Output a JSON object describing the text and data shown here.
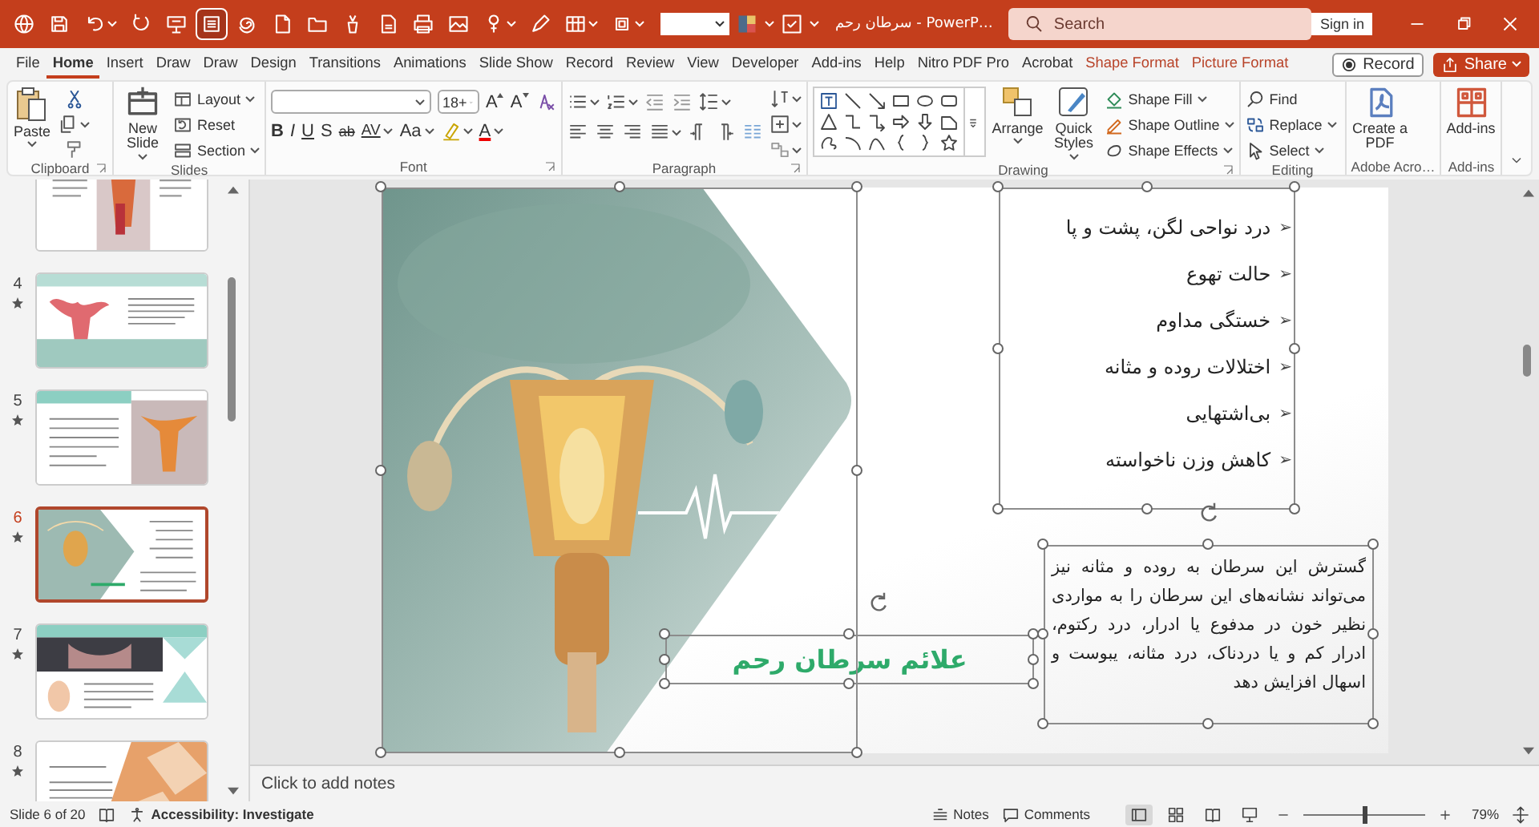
{
  "title_bar": {
    "document_title": "سرطان رحم - PowerP…",
    "search_placeholder": "Search",
    "sign_in": "Sign in"
  },
  "menu_tabs": [
    {
      "label": "File",
      "selected": false,
      "kind": "normal"
    },
    {
      "label": "Home",
      "selected": true,
      "kind": "normal"
    },
    {
      "label": "Insert",
      "selected": false,
      "kind": "normal"
    },
    {
      "label": "Draw",
      "selected": false,
      "kind": "normal"
    },
    {
      "label": "Draw",
      "selected": false,
      "kind": "normal"
    },
    {
      "label": "Design",
      "selected": false,
      "kind": "normal"
    },
    {
      "label": "Transitions",
      "selected": false,
      "kind": "normal"
    },
    {
      "label": "Animations",
      "selected": false,
      "kind": "normal"
    },
    {
      "label": "Slide Show",
      "selected": false,
      "kind": "normal"
    },
    {
      "label": "Record",
      "selected": false,
      "kind": "normal"
    },
    {
      "label": "Review",
      "selected": false,
      "kind": "normal"
    },
    {
      "label": "View",
      "selected": false,
      "kind": "normal"
    },
    {
      "label": "Developer",
      "selected": false,
      "kind": "normal"
    },
    {
      "label": "Add-ins",
      "selected": false,
      "kind": "normal"
    },
    {
      "label": "Help",
      "selected": false,
      "kind": "normal"
    },
    {
      "label": "Nitro PDF Pro",
      "selected": false,
      "kind": "normal"
    },
    {
      "label": "Acrobat",
      "selected": false,
      "kind": "normal"
    },
    {
      "label": "Shape Format",
      "selected": false,
      "kind": "contextual"
    },
    {
      "label": "Picture Format",
      "selected": false,
      "kind": "contextual"
    }
  ],
  "record_button": "Record",
  "share_button": "Share",
  "ribbon": {
    "clipboard": {
      "label": "Clipboard",
      "paste": "Paste"
    },
    "slides": {
      "label": "Slides",
      "new_slide": "New Slide",
      "layout": "Layout",
      "reset": "Reset",
      "section": "Section"
    },
    "font": {
      "label": "Font",
      "font_size": "18+",
      "grow": "A",
      "shrink": "A",
      "bold": "B",
      "italic": "I",
      "underline": "U",
      "shadow": "S",
      "strikethrough": "ab",
      "spacing": "AV",
      "change_case": "Aa",
      "font_color": "A"
    },
    "paragraph": {
      "label": "Paragraph"
    },
    "drawing": {
      "label": "Drawing",
      "arrange": "Arrange",
      "quick_styles": "Quick Styles",
      "shape_fill": "Shape Fill",
      "shape_outline": "Shape Outline",
      "shape_effects": "Shape Effects"
    },
    "editing": {
      "label": "Editing",
      "find": "Find",
      "replace": "Replace",
      "select": "Select"
    },
    "adobe": {
      "label": "Adobe Acro…",
      "create_pdf": "Create a PDF"
    },
    "add_ins": {
      "label": "Add-ins",
      "button": "Add-ins"
    }
  },
  "slides_panel": [
    {
      "selected": false
    },
    {
      "number": "4",
      "selected": false
    },
    {
      "number": "5",
      "selected": false
    },
    {
      "number": "6",
      "selected": true
    },
    {
      "number": "7",
      "selected": false
    },
    {
      "number": "8",
      "selected": false
    }
  ],
  "slide": {
    "bullets": [
      {
        "marker": "➢",
        "text": "درد نواحی لگن، پشت و پا"
      },
      {
        "marker": "➢",
        "text": "حالت تهوع"
      },
      {
        "marker": "➢",
        "text": "خستگی مداوم"
      },
      {
        "marker": "➢",
        "text": "اختلالات روده و مثانه"
      },
      {
        "marker": "➢",
        "text": "بی‌اشتهایی"
      },
      {
        "marker": "➢",
        "text": "کاهش وزن ناخواسته"
      }
    ],
    "title": "علائم سرطان رحم",
    "paragraph": "گسترش این سرطان به روده و مثانه نیز می‌تواند نشانه‌های این سرطان را به مواردی نظیر خون در مدفوع یا ادرار، درد رکتوم، ادرار کم و یا دردناک، درد مثانه، یبوست و اسهال افزایش دهد"
  },
  "notes_placeholder": "Click to add notes",
  "status_bar": {
    "slide_counter": "Slide 6 of 20",
    "accessibility": "Accessibility: Investigate",
    "notes": "Notes",
    "comments": "Comments",
    "views": [
      {
        "kind": "normal",
        "selected": true
      },
      {
        "kind": "sorter",
        "selected": false
      },
      {
        "kind": "reading",
        "selected": false
      },
      {
        "kind": "slideshow",
        "selected": false
      }
    ],
    "zoom_slider": {
      "level": 0.5
    },
    "zoom": "79%"
  }
}
